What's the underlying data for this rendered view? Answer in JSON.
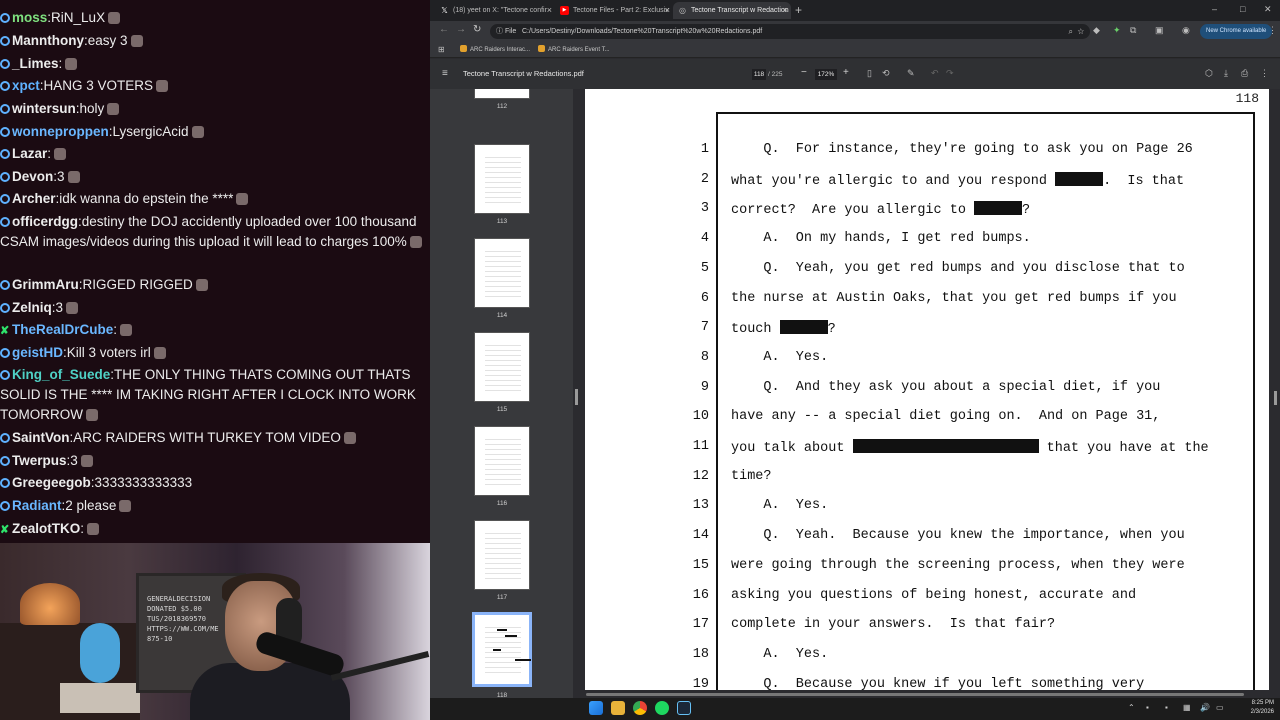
{
  "chat": {
    "messages": [
      {
        "badge": "dot",
        "user": "moss",
        "color": "#7ee07e",
        "text": "RiN_LuX"
      },
      {
        "badge": "dot",
        "user": "Mannthony",
        "color": "#ececec",
        "text": "easy 3"
      },
      {
        "badge": "dot",
        "user": "_Limes",
        "color": "#ececec",
        "text": ""
      },
      {
        "badge": "dot",
        "user": "xpct",
        "color": "#5fb2ff",
        "text": "HANG 3 VOTERS"
      },
      {
        "badge": "dot",
        "user": "wintersun",
        "color": "#ececec",
        "text": "holy"
      },
      {
        "badge": "dot",
        "user": "wonneproppen",
        "color": "#6ab7ff",
        "text": "LysergicAcid"
      },
      {
        "badge": "dot",
        "user": "Lazar",
        "color": "#ececec",
        "text": ""
      },
      {
        "badge": "dot",
        "user": "Devon",
        "color": "#ececec",
        "text": "3"
      },
      {
        "badge": "dot",
        "user": "Archer",
        "color": "#ececec",
        "text": "idk wanna do epstein the ****"
      },
      {
        "badge": "dot",
        "user": "officerdgg",
        "color": "#ececec",
        "text": "destiny the DOJ accidently uploaded over 100 thousand CSAM images/videos during this upload it will lead to charges 100%"
      },
      {
        "badge": "dot",
        "user": "GrimmAru",
        "color": "#ececec",
        "text": "RIGGED RIGGED"
      },
      {
        "badge": "dot",
        "user": "Zelniq",
        "color": "#ececec",
        "text": "3"
      },
      {
        "badge": "cross",
        "user": "TheRealDrCube",
        "color": "#6ab7ff",
        "text": ""
      },
      {
        "badge": "dot",
        "user": "geistHD",
        "color": "#6ab7ff",
        "text": "Kill 3 voters irl"
      },
      {
        "badge": "dot",
        "user": "King_of_Suede",
        "color": "#4fd1c5",
        "text": "THE ONLY THING THATS COMING OUT THATS SOLID IS THE **** IM TAKING RIGHT AFTER I CLOCK INTO WORK TOMORROW"
      },
      {
        "badge": "dot",
        "user": "SaintVon",
        "color": "#ececec",
        "text": "ARC RAIDERS WITH TURKEY TOM VIDEO"
      },
      {
        "badge": "dot",
        "user": "Twerpus",
        "color": "#ececec",
        "text": "3"
      },
      {
        "badge": "dot",
        "user": "Greegeegob",
        "color": "#ececec",
        "text": "3333333333333"
      },
      {
        "badge": "dot",
        "user": "Radiant",
        "color": "#6ab7ff",
        "text": "2 please"
      },
      {
        "badge": "cross",
        "user": "ZealotTKO",
        "color": "#ececec",
        "text": ""
      }
    ]
  },
  "webcam": {
    "board_text": "GENERALDECISION DONATED $5.00 TUS/2018369570 HTTPS://WW.COM/ME 875-10"
  },
  "browser": {
    "tabs": [
      {
        "label": "(18) yeet on X: \"Tectone confir",
        "icon": "x-logo-icon",
        "active": false
      },
      {
        "label": "Tectone Files - Part 2: Exclusiv",
        "icon": "youtube-icon",
        "active": false
      },
      {
        "label": "Tectone Transcript w Redaction",
        "icon": "globe-icon",
        "active": true
      }
    ],
    "url_prefix": "File",
    "url": "C:/Users/Destiny/Downloads/Tectone%20Transcript%20w%20Redactions.pdf",
    "update_label": "New Chrome available",
    "bookmarks": [
      "ARC Raiders Interac...",
      "ARC Raiders Event T..."
    ]
  },
  "pdf": {
    "title": "Tectone Transcript w Redactions.pdf",
    "current_page": "118",
    "total_pages": "/ 225",
    "zoom": "172%",
    "thumbnails": [
      "112",
      "113",
      "114",
      "115",
      "116",
      "117",
      "118"
    ],
    "page_number": "118",
    "lines": [
      {
        "n": "1",
        "segs": [
          {
            "t": "    Q.  For instance, they're going to ask you on Page 26"
          }
        ]
      },
      {
        "n": "2",
        "segs": [
          {
            "t": "what you're allergic to and you respond "
          },
          {
            "r": 48
          },
          {
            "t": ".  Is that"
          }
        ]
      },
      {
        "n": "3",
        "segs": [
          {
            "t": "correct?  Are you allergic to "
          },
          {
            "r": 48
          },
          {
            "t": "?"
          }
        ]
      },
      {
        "n": "4",
        "segs": [
          {
            "t": "    A.  On my hands, I get red bumps."
          }
        ]
      },
      {
        "n": "5",
        "segs": [
          {
            "t": "    Q.  Yeah, you get red bumps and you disclose that to"
          }
        ]
      },
      {
        "n": "6",
        "segs": [
          {
            "t": "the nurse at Austin Oaks, that you get red bumps if you"
          }
        ]
      },
      {
        "n": "7",
        "segs": [
          {
            "t": "touch "
          },
          {
            "r": 48
          },
          {
            "t": "?"
          }
        ]
      },
      {
        "n": "8",
        "segs": [
          {
            "t": "    A.  Yes."
          }
        ]
      },
      {
        "n": "9",
        "segs": [
          {
            "t": "    Q.  And they ask you about a special diet, if you"
          }
        ]
      },
      {
        "n": "10",
        "segs": [
          {
            "t": "have any -- a special diet going on.  And on Page 31,"
          }
        ]
      },
      {
        "n": "11",
        "segs": [
          {
            "t": "you talk about "
          },
          {
            "r": 186
          },
          {
            "t": " that you have at the"
          }
        ]
      },
      {
        "n": "12",
        "segs": [
          {
            "t": "time?"
          }
        ]
      },
      {
        "n": "13",
        "segs": [
          {
            "t": "    A.  Yes."
          }
        ]
      },
      {
        "n": "14",
        "segs": [
          {
            "t": "    Q.  Yeah.  Because you knew the importance, when you"
          }
        ]
      },
      {
        "n": "15",
        "segs": [
          {
            "t": "were going through the screening process, when they were"
          }
        ]
      },
      {
        "n": "16",
        "segs": [
          {
            "t": "asking you questions of being honest, accurate and"
          }
        ]
      },
      {
        "n": "17",
        "segs": [
          {
            "t": "complete in your answers.  Is that fair?"
          }
        ]
      },
      {
        "n": "18",
        "segs": [
          {
            "t": "    A.  Yes."
          }
        ]
      },
      {
        "n": "19",
        "segs": [
          {
            "t": "    Q.  Because you knew if you left something very"
          }
        ]
      }
    ]
  },
  "taskbar": {
    "time": "8:25 PM",
    "date": "2/3/2026"
  }
}
